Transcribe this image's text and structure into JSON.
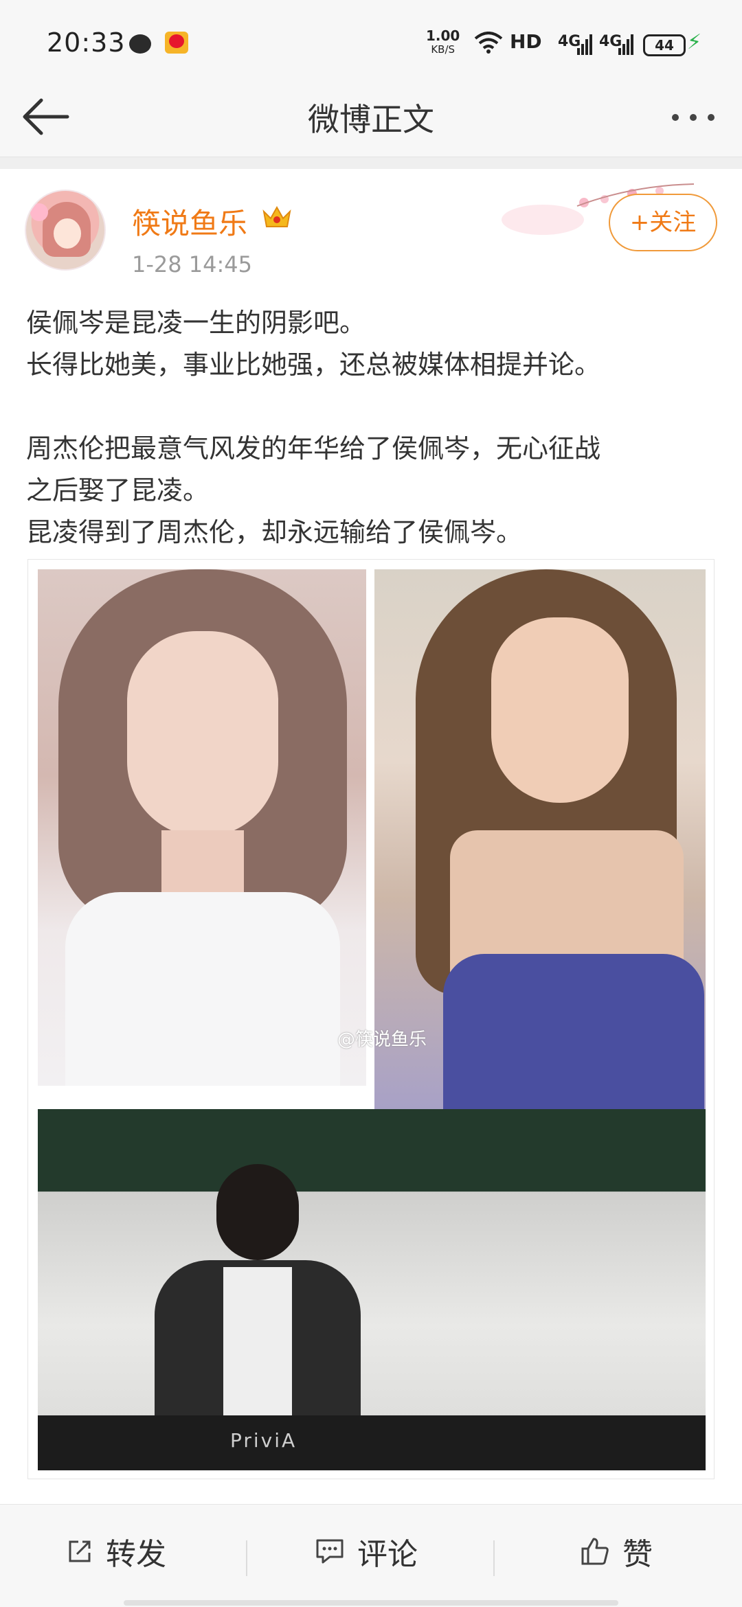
{
  "status_bar": {
    "time": "20:33",
    "net_speed_value": "1.00",
    "net_speed_unit": "KB/S",
    "hd": "HD",
    "signal1": "4G",
    "signal2": "4G",
    "battery": "44"
  },
  "nav": {
    "title": "微博正文"
  },
  "post": {
    "username": "筷说鱼乐",
    "time": "1-28 14:45",
    "follow_label": "+关注",
    "lines": [
      "侯佩岑是昆凌一生的阴影吧。",
      "长得比她美，事业比她强，还总被媒体相提并论。",
      "",
      "周杰伦把最意气风发的年华给了侯佩岑，无心征战",
      "之后娶了昆凌。",
      "昆凌得到了周杰伦，却永远输给了侯佩岑。"
    ],
    "image_watermark": "@筷说鱼乐",
    "piano_brand": "PriviA"
  },
  "actions": {
    "repost": "转发",
    "comment": "评论",
    "like": "赞"
  }
}
